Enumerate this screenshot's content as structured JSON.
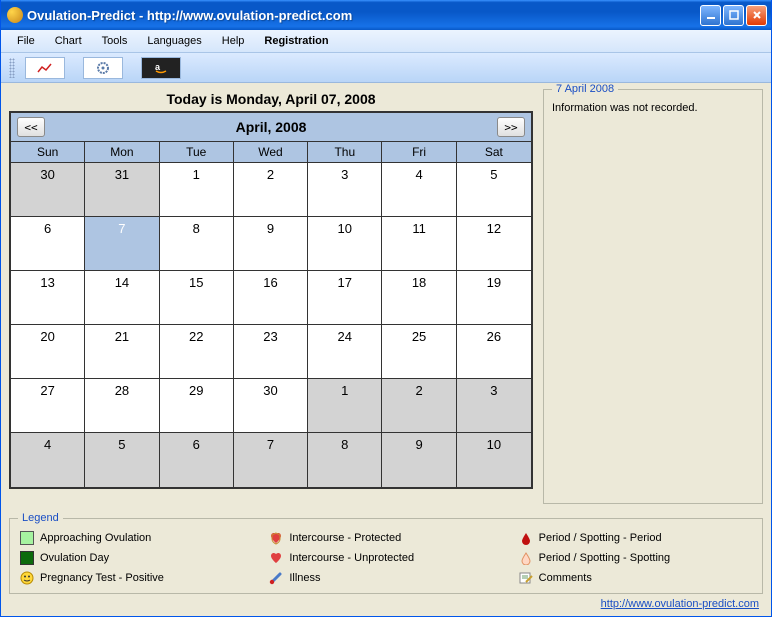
{
  "window": {
    "title": "Ovulation-Predict - http://www.ovulation-predict.com"
  },
  "menu": {
    "file": "File",
    "chart": "Chart",
    "tools": "Tools",
    "languages": "Languages",
    "help": "Help",
    "registration": "Registration"
  },
  "today_label": "Today is Monday, April 07, 2008",
  "calendar": {
    "title": "April, 2008",
    "dow": [
      "Sun",
      "Mon",
      "Tue",
      "Wed",
      "Thu",
      "Fri",
      "Sat"
    ],
    "cells": [
      {
        "n": "30",
        "other": true
      },
      {
        "n": "31",
        "other": true
      },
      {
        "n": "1"
      },
      {
        "n": "2"
      },
      {
        "n": "3"
      },
      {
        "n": "4"
      },
      {
        "n": "5"
      },
      {
        "n": "6"
      },
      {
        "n": "7",
        "today": true
      },
      {
        "n": "8"
      },
      {
        "n": "9"
      },
      {
        "n": "10"
      },
      {
        "n": "11"
      },
      {
        "n": "12"
      },
      {
        "n": "13"
      },
      {
        "n": "14"
      },
      {
        "n": "15"
      },
      {
        "n": "16"
      },
      {
        "n": "17"
      },
      {
        "n": "18"
      },
      {
        "n": "19"
      },
      {
        "n": "20"
      },
      {
        "n": "21"
      },
      {
        "n": "22"
      },
      {
        "n": "23"
      },
      {
        "n": "24"
      },
      {
        "n": "25"
      },
      {
        "n": "26"
      },
      {
        "n": "27"
      },
      {
        "n": "28"
      },
      {
        "n": "29"
      },
      {
        "n": "30"
      },
      {
        "n": "1",
        "other": true
      },
      {
        "n": "2",
        "other": true
      },
      {
        "n": "3",
        "other": true
      },
      {
        "n": "4",
        "other": true
      },
      {
        "n": "5",
        "other": true
      },
      {
        "n": "6",
        "other": true
      },
      {
        "n": "7",
        "other": true
      },
      {
        "n": "8",
        "other": true
      },
      {
        "n": "9",
        "other": true
      },
      {
        "n": "10",
        "other": true
      }
    ]
  },
  "info": {
    "date_label": "7 April 2008",
    "message": "Information was not recorded."
  },
  "legend": {
    "label": "Legend",
    "items": {
      "approaching": "Approaching Ovulation",
      "protected": "Intercourse - Protected",
      "period": "Period / Spotting - Period",
      "ovday": "Ovulation Day",
      "unprotected": "Intercourse - Unprotected",
      "spotting": "Period / Spotting - Spotting",
      "pregnancy": "Pregnancy Test - Positive",
      "illness": "Illness",
      "comments": "Comments"
    }
  },
  "footer": {
    "link": "http://www.ovulation-predict.com"
  }
}
